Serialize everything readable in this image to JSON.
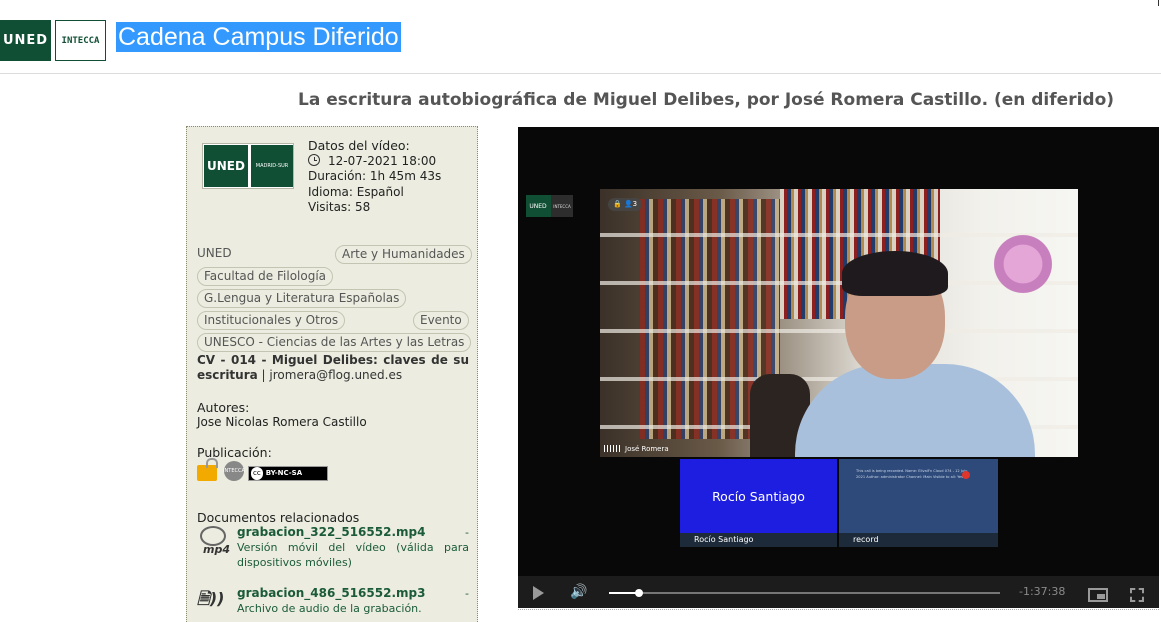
{
  "header": {
    "logo_uned": "UNED",
    "logo_intecca": "INTECCA",
    "site_title": "Cadena Campus Diferido"
  },
  "video_title": "La escritura autobiográfica de Miguel Delibes, por José Romera Castillo. (en diferido)",
  "info": {
    "channel_logo_left": "UNED",
    "channel_logo_right": "MADRID-SUR",
    "datos_label": "Datos del vídeo:",
    "date": "12-07-2021 18:00",
    "duracion": "Duración: 1h 45m 43s",
    "idioma": "Idioma: Español",
    "visitas": "Visitas: 58"
  },
  "tags": {
    "uned": "UNED",
    "arte": "Arte y Humanidades",
    "facultad": "Facultad de Filología",
    "grado": "G.Lengua y Literatura Españolas",
    "institucionales": "Institucionales y Otros",
    "evento": "Evento",
    "unesco": "UNESCO - Ciencias de las Artes y las Letras"
  },
  "description": {
    "bold": "CV - 014 - Miguel Delibes: claves de su escritura",
    "rest": " | jromera@flog.uned.es"
  },
  "autores": {
    "label": "Autores:",
    "value": "Jose Nicolas Romera Castillo"
  },
  "publicacion": {
    "label": "Publicación:",
    "license": "BY-NC-SA",
    "cc": "cc",
    "stamp_text": "INTECCA"
  },
  "documentos": {
    "label": "Documentos relacionados",
    "items": [
      {
        "icon": "mp4",
        "file": "grabacion_322_516552.mp4",
        "desc": " - Versión móvil del vídeo (válida para dispositivos móviles)"
      },
      {
        "icon": "speaker",
        "file": "grabacion_486_516552.mp3",
        "desc": " - Archivo de audio de la grabación."
      }
    ]
  },
  "player": {
    "logo_left": "UNED",
    "logo_right": "INTECCA",
    "participants_badge": "🔒 👤3",
    "main_speaker": "José Romera",
    "tile_rocio_big": "Rocío Santiago",
    "tile_rocio_caption": "Rocío Santiago",
    "tile_record_caption": "record",
    "record_notes": "This call is being recorded. Name: ElivalFn Cloud 074 - 12 July 2021 Author: administrator Channel: Main Visible to all: Yes",
    "time_remaining": "-1:37:38",
    "progress_fraction": 0.078
  }
}
